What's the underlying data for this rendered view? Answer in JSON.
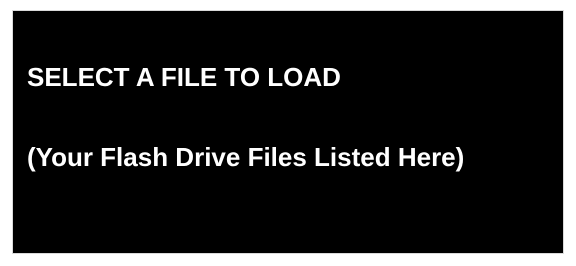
{
  "screen": {
    "title": "SELECT A FILE TO LOAD",
    "file_list_placeholder": "(Your Flash Drive Files Listed Here)"
  },
  "colors": {
    "screen_background": "#000000",
    "text": "#ffffff",
    "page_background": "#ffffff"
  }
}
